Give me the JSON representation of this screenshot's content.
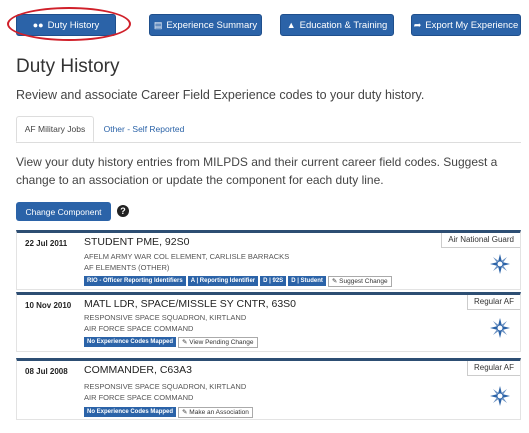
{
  "nav": {
    "duty_history": "Duty History",
    "experience_summary": "Experience Summary",
    "education_training": "Education & Training",
    "export": "Export My Experience"
  },
  "page": {
    "title": "Duty History",
    "lead": "Review and associate Career Field Experience codes to your duty history.",
    "description": "View your duty history entries from MILPDS and their current career field codes. Suggest a change to an association or update the component for each duty line."
  },
  "tabs": [
    "AF Military Jobs",
    "Other - Self Reported"
  ],
  "change_component_label": "Change Component",
  "help_label": "?",
  "entries": [
    {
      "date": "22 Jul 2011",
      "title": "STUDENT PME, 92S0",
      "org1": "AFELM ARMY WAR COL ELEMENT, CARLISLE BARRACKS",
      "org2": "AF ELEMENTS (OTHER)",
      "badges": [
        "RIO - Officer Reporting Identifiers",
        "A | Reporting Identifier",
        "D | 92S",
        "D | Student"
      ],
      "action": "Suggest Change",
      "component": "Air National Guard"
    },
    {
      "date": "10 Nov 2010",
      "title": "MATL LDR, SPACE/MISSLE SY CNTR, 63S0",
      "org1": "RESPONSIVE SPACE SQUADRON, KIRTLAND",
      "org2": "AIR FORCE SPACE COMMAND",
      "badges": [
        "No Experience Codes Mapped"
      ],
      "action": "View Pending Change",
      "component": "Regular AF"
    },
    {
      "date": "08 Jul 2008",
      "title": "COMMANDER, C63A3",
      "org1": "RESPONSIVE SPACE SQUADRON, KIRTLAND",
      "org2": "AIR FORCE SPACE COMMAND",
      "badges": [
        "No Experience Codes Mapped"
      ],
      "action": "Make an Association",
      "component": "Regular AF"
    }
  ],
  "colors": {
    "primary": "#2b63a8",
    "highlight_circle": "#d0202a",
    "card_top": "#2d4e73"
  },
  "icons": {
    "duty": "users-icon",
    "summary": "list-icon",
    "education": "bank-icon",
    "export": "share-icon",
    "action": "pencil-icon",
    "emblem": "af-star-emblem-icon"
  }
}
